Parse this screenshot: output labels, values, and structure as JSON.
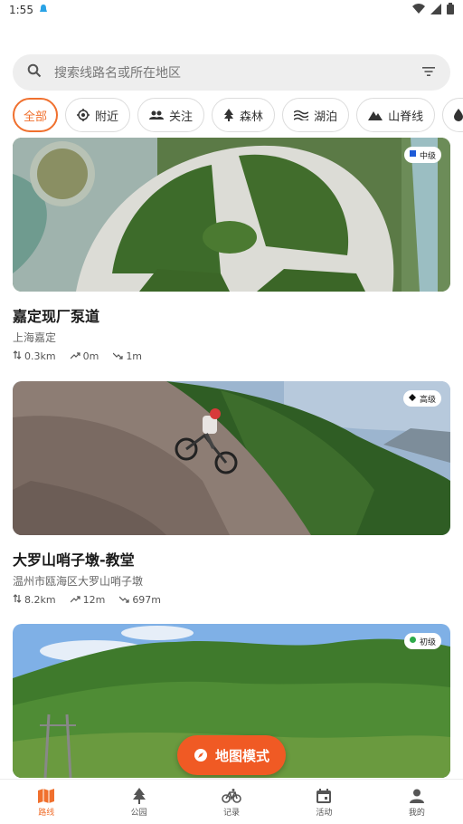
{
  "status_bar": {
    "time": "1:55"
  },
  "search": {
    "placeholder": "搜索线路名或所在地区"
  },
  "filters": [
    {
      "label": "全部",
      "icon": "",
      "active": true
    },
    {
      "label": "附近",
      "icon": "location-icon"
    },
    {
      "label": "关注",
      "icon": "people-icon"
    },
    {
      "label": "森林",
      "icon": "tree-icon"
    },
    {
      "label": "湖泊",
      "icon": "wave-icon"
    },
    {
      "label": "山脊线",
      "icon": "mountain-icon"
    },
    {
      "label": "溪流",
      "icon": "drop-icon"
    }
  ],
  "routes": [
    {
      "title": "嘉定现厂泵道",
      "location": "上海嘉定",
      "level": "中级",
      "level_color": "#1e5bd8",
      "distance": "0.3km",
      "ascent": "0m",
      "descent": "1m"
    },
    {
      "title": "大罗山哨子墩-教堂",
      "location": "温州市瓯海区大罗山哨子墩",
      "level": "高级",
      "level_color": "#111111",
      "distance": "8.2km",
      "ascent": "12m",
      "descent": "697m"
    },
    {
      "title": "",
      "location": "",
      "level": "初级",
      "level_color": "#2eaa4a"
    }
  ],
  "fab": {
    "label": "地图模式"
  },
  "nav": [
    {
      "label": "路线",
      "icon": "map-icon",
      "active": true
    },
    {
      "label": "公园",
      "icon": "tree-icon"
    },
    {
      "label": "记录",
      "icon": "bike-icon"
    },
    {
      "label": "活动",
      "icon": "calendar-icon"
    },
    {
      "label": "我的",
      "icon": "person-icon"
    }
  ],
  "colors": {
    "accent": "#f0702e",
    "fab": "#f05a24"
  }
}
